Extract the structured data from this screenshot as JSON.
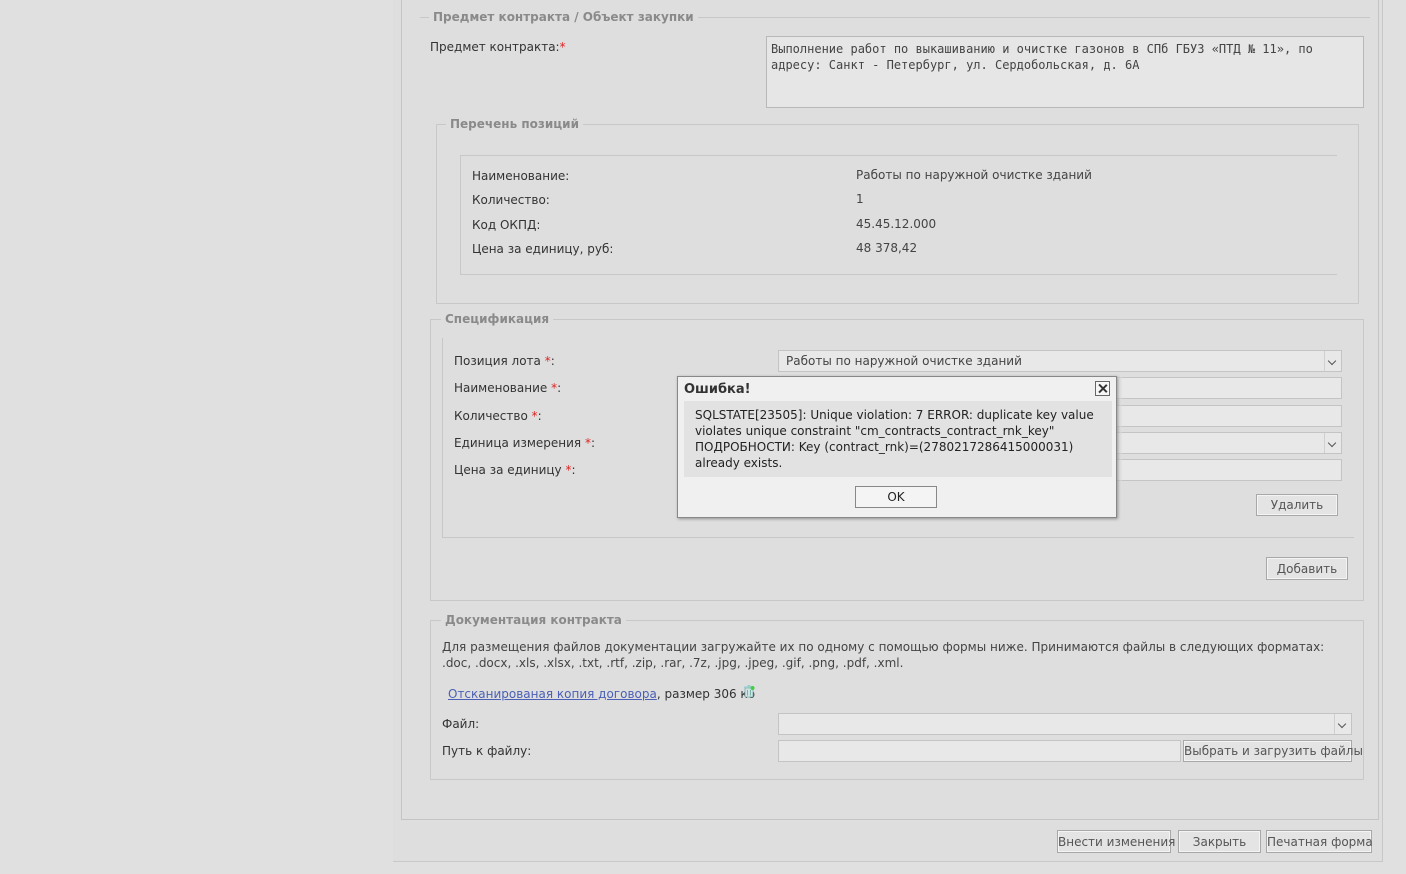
{
  "subject_section": {
    "legend": "Предмет контракта / Объект закупки",
    "contract_subject_label": "Предмет контракта:",
    "contract_subject_value": "Выполнение работ по выкашиванию и очистке газонов в СПб ГБУЗ «ПТД № 11»,  по адресу: Санкт - Петербург, ул. Сердобольская, д. 6А"
  },
  "positions_section": {
    "legend": "Перечень позиций",
    "rows": [
      {
        "label": "Наименование:",
        "value": "Работы по наружной очистке зданий"
      },
      {
        "label": "Количество:",
        "value": "1"
      },
      {
        "label": "Код ОКПД:",
        "value": "45.45.12.000"
      },
      {
        "label": "Цена за единицу, руб:",
        "value": "48 378,42"
      }
    ]
  },
  "spec_section": {
    "legend": "Спецификация",
    "lot_position_label": "Позиция лота",
    "name_label": "Наименование",
    "quantity_label": "Количество",
    "unit_label": "Единица измерения",
    "price_label": "Цена за единицу",
    "required_mark": "*",
    "colon": ":",
    "lot_position_value": "Работы по наружной очистке зданий",
    "delete_button": "Удалить",
    "add_button": "Добавить"
  },
  "docs_section": {
    "legend": "Документация контракта",
    "info_text": "Для размещения файлов документации загружайте их по одному с помощью формы ниже. Принимаются файлы в следующих форматах: .doc, .docx, .xls, .xlsx, .txt, .rtf, .zip, .rar, .7z, .jpg, .jpeg, .gif, .png, .pdf, .xml.",
    "file_link": "Отсканированая копия договора",
    "file_size": ", размер 306 кб",
    "file_label": "Файл:",
    "path_label": "Путь к файлу:",
    "upload_button": "Выбрать и загрузить файлы"
  },
  "footer": {
    "save_button": "Внести изменения",
    "close_button": "Закрыть",
    "print_button": "Печатная форма"
  },
  "dialog": {
    "title": "Ошибка!",
    "message": "SQLSTATE[23505]: Unique violation: 7 ERROR: duplicate key value violates unique constraint \"cm_contracts_contract_rnk_key\" ПОДРОБНОСТИ: Key (contract_rnk)=(2780217286415000031) already exists.",
    "ok_button": "OK"
  }
}
